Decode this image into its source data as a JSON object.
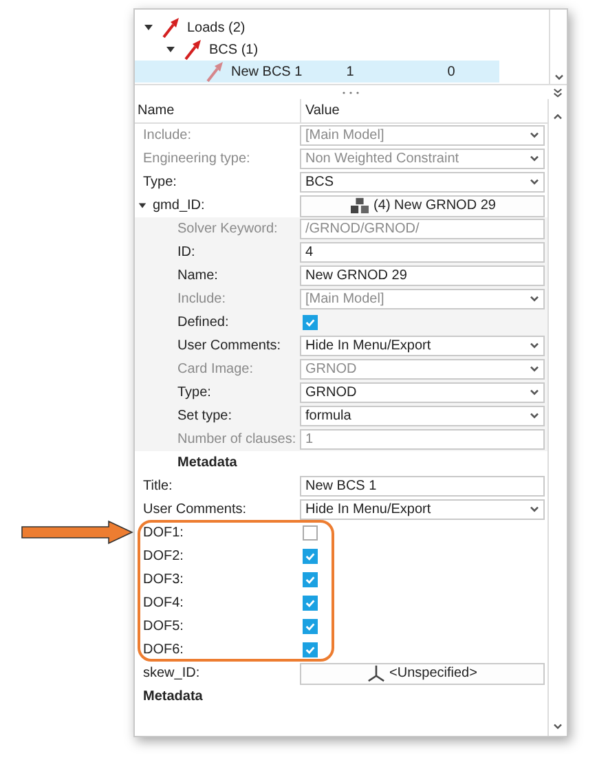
{
  "tree": [
    {
      "label": "Loads (2)",
      "expanded": true,
      "children": [
        {
          "label": "BCS (1)",
          "expanded": true,
          "children": [
            {
              "label": "New BCS 1",
              "column_2": "1",
              "column_3": "0",
              "selected": true
            }
          ]
        }
      ]
    }
  ],
  "properties": {
    "columns": [
      "Name",
      "Value"
    ],
    "rows": [
      {
        "kind": "dropdown",
        "label": "Include:",
        "value": "[Main Model]",
        "disabled": true
      },
      {
        "kind": "dropdown",
        "label": "Engineering type:",
        "value": "Non Weighted Constraint",
        "disabled": true
      },
      {
        "kind": "dropdown",
        "label": "Type:",
        "value": "BCS",
        "disabled": false
      },
      {
        "kind": "set-button",
        "label": "gmd_ID:",
        "value": "(4) New GRNOD 29",
        "disabled": false,
        "expanded": true,
        "children": [
          {
            "kind": "text",
            "label": "Solver Keyword:",
            "value": "/GRNOD/GRNOD/",
            "disabled": true
          },
          {
            "kind": "text",
            "label": "ID:",
            "value": "4",
            "disabled": false
          },
          {
            "kind": "text",
            "label": "Name:",
            "value": "New GRNOD 29",
            "disabled": false
          },
          {
            "kind": "dropdown",
            "label": "Include:",
            "value": "[Main Model]",
            "disabled": true
          },
          {
            "kind": "checkbox",
            "label": "Defined:",
            "checked": true,
            "disabled": false
          },
          {
            "kind": "dropdown",
            "label": "User Comments:",
            "value": "Hide In Menu/Export",
            "disabled": false
          },
          {
            "kind": "dropdown",
            "label": "Card Image:",
            "value": "GRNOD",
            "disabled": true
          },
          {
            "kind": "dropdown",
            "label": "Type:",
            "value": "GRNOD",
            "disabled": false
          },
          {
            "kind": "dropdown",
            "label": "Set type:",
            "value": "formula",
            "disabled": false
          },
          {
            "kind": "text",
            "label": "Number of clauses:",
            "value": "1",
            "disabled": true
          },
          {
            "kind": "section",
            "label": "Metadata"
          }
        ]
      },
      {
        "kind": "text",
        "label": "Title:",
        "value": "New BCS 1",
        "disabled": false
      },
      {
        "kind": "dropdown",
        "label": "User Comments:",
        "value": "Hide In Menu/Export",
        "disabled": false
      },
      {
        "kind": "checkbox",
        "label": "DOF1:",
        "checked": false,
        "disabled": false
      },
      {
        "kind": "checkbox",
        "label": "DOF2:",
        "checked": true,
        "disabled": false
      },
      {
        "kind": "checkbox",
        "label": "DOF3:",
        "checked": true,
        "disabled": false
      },
      {
        "kind": "checkbox",
        "label": "DOF4:",
        "checked": true,
        "disabled": false
      },
      {
        "kind": "checkbox",
        "label": "DOF5:",
        "checked": true,
        "disabled": false
      },
      {
        "kind": "checkbox",
        "label": "DOF6:",
        "checked": true,
        "disabled": false
      },
      {
        "kind": "system-button",
        "label": "skew_ID:",
        "value": "<Unspecified>",
        "disabled": false
      },
      {
        "kind": "section",
        "label": "Metadata"
      }
    ]
  }
}
